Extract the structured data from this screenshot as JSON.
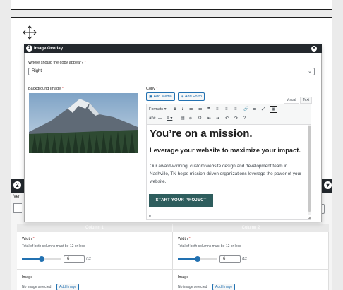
{
  "item1": {
    "badge": "1",
    "title": "Image Overlay"
  },
  "item2": {
    "badge": "2",
    "ver_label": "Ver",
    "dropdown_glyph": "⌄"
  },
  "position": {
    "label": "Where should the copy appear?",
    "value": "Right",
    "required_mark": "*"
  },
  "background_image": {
    "label": "Background Image",
    "required_mark": "*"
  },
  "copy": {
    "label": "Copy",
    "required_mark": "*",
    "add_media": "Add Media",
    "add_form": "Add Form",
    "tab_visual": "Visual",
    "tab_text": "Text",
    "formats": "Formats ▾",
    "heading": "You’re on a mission.",
    "subheading": "Leverage your website to maximize your impact.",
    "paragraph": "Our award-winning, custom website design and development team in Nashville, TN helps mission-driven organizations leverage the power of your website.",
    "cta": "START YOUR PROJECT",
    "path": "P"
  },
  "columns": [
    {
      "title": "Column 1",
      "width_label": "Width",
      "width_help": "Total of both columns must be 12 or less",
      "width_value": "6",
      "width_suffix": "/12",
      "width_fraction": 0.5,
      "image_label": "Image",
      "image_status": "No image selected",
      "image_button": "Add Image"
    },
    {
      "title": "Column 2",
      "width_label": "Width",
      "width_help": "Total of both columns must be 12 or less",
      "width_value": "6",
      "width_suffix": "/12",
      "width_fraction": 0.5,
      "image_label": "Image",
      "image_status": "No image selected",
      "image_button": "Add Image"
    }
  ],
  "colors": {
    "header_dark": "#23282d",
    "accent_blue": "#2271b1",
    "cta_teal": "#2e5d5d"
  }
}
